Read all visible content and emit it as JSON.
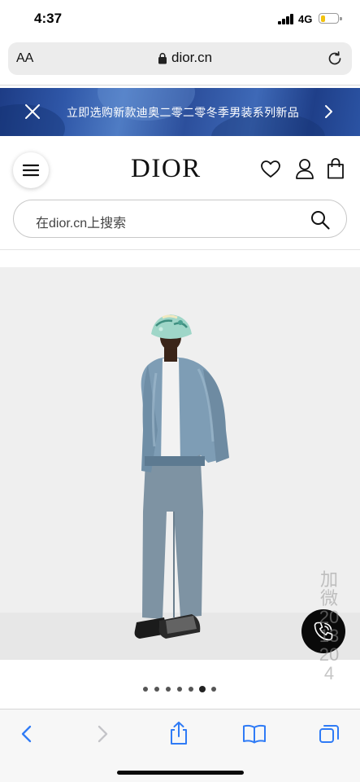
{
  "status_bar": {
    "time": "4:37",
    "network": "4G",
    "battery_level": 0.3
  },
  "address_bar": {
    "text_size_label": "AA",
    "url": "dior.cn"
  },
  "promo_banner": {
    "text": "立即选购新款迪奥二零二零冬季男装系列新品"
  },
  "header": {
    "logo": "DIOR"
  },
  "search": {
    "placeholder": "在dior.cn上搜索"
  },
  "carousel": {
    "slide_count": 7,
    "active_index": 5
  },
  "watermark": "加微2013204",
  "colors": {
    "banner_blue": "#2f57a8",
    "chat_button": "#0a0a0a",
    "jacket": "#7e9db5",
    "trousers": "#7e93a3"
  },
  "icons": [
    "lock-icon",
    "reload-icon",
    "close-icon",
    "chevron-right-icon",
    "menu-icon",
    "heart-icon",
    "account-icon",
    "bag-icon",
    "search-icon",
    "phone-icon",
    "back-icon",
    "forward-icon",
    "share-icon",
    "bookmarks-icon",
    "tabs-icon"
  ]
}
